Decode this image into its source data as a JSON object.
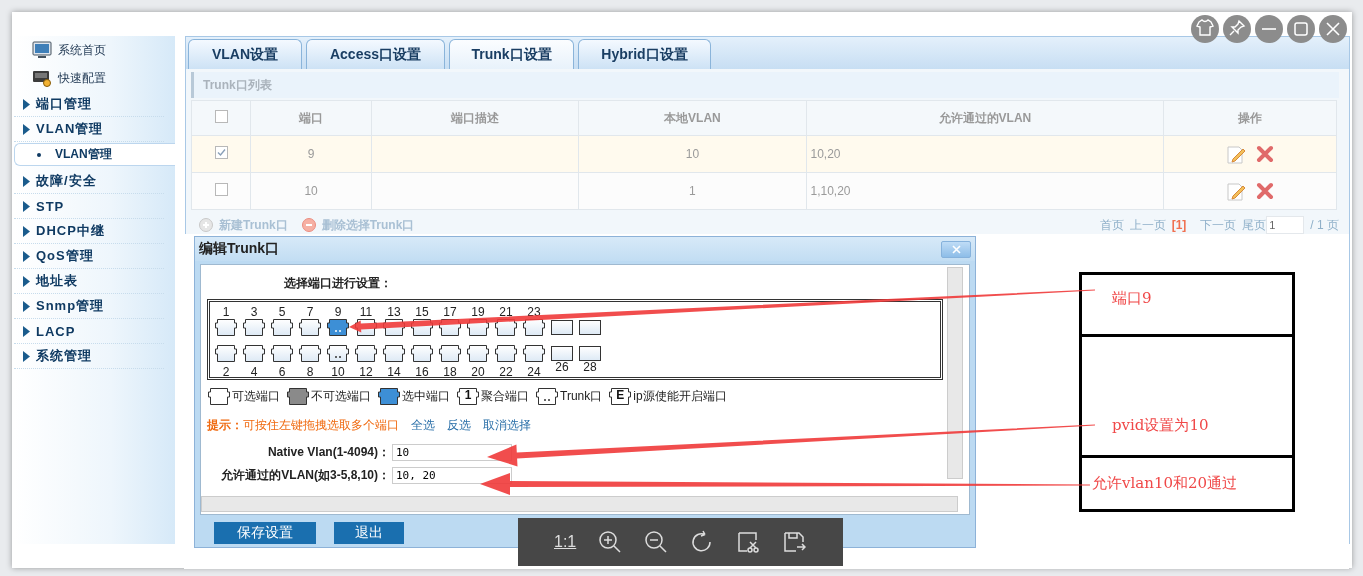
{
  "sidebar": {
    "items": [
      {
        "kind": "shortcut",
        "label": "系统首页"
      },
      {
        "kind": "shortcut",
        "label": "快速配置"
      },
      {
        "kind": "group",
        "label": "端口管理"
      },
      {
        "kind": "group",
        "label": "VLAN管理",
        "children": [
          {
            "label": "VLAN管理",
            "selected": true
          }
        ]
      },
      {
        "kind": "group",
        "label": "故障/安全"
      },
      {
        "kind": "group",
        "label": "STP"
      },
      {
        "kind": "group",
        "label": "DHCP中继"
      },
      {
        "kind": "group",
        "label": "QoS管理"
      },
      {
        "kind": "group",
        "label": "地址表"
      },
      {
        "kind": "group",
        "label": "Snmp管理"
      },
      {
        "kind": "group",
        "label": "LACP"
      },
      {
        "kind": "group",
        "label": "系统管理"
      }
    ]
  },
  "tabs": [
    {
      "label": "VLAN设置",
      "selected": false
    },
    {
      "label": "Access口设置",
      "selected": false
    },
    {
      "label": "Trunk口设置",
      "selected": true
    },
    {
      "label": "Hybrid口设置",
      "selected": false
    }
  ],
  "list": {
    "title": "Trunk口列表",
    "header_checked": false,
    "columns": [
      "端口",
      "端口描述",
      "本地VLAN",
      "允许通过的VLAN",
      "操作"
    ],
    "rows": [
      {
        "checked": true,
        "port": "9",
        "local_vlan": "10",
        "allowed_vlan": "10,20"
      },
      {
        "checked": false,
        "port": "10",
        "local_vlan": "1",
        "allowed_vlan": "1,10,20"
      }
    ],
    "actions": [
      {
        "kind": "add",
        "label": "新建Trunk口"
      },
      {
        "kind": "delete",
        "label": "删除选择Trunk口"
      }
    ],
    "pagination": {
      "first": "首页",
      "prev": "上一页",
      "current": "[1]",
      "next": "下一页",
      "last": "尾页",
      "page_input": "1",
      "total": "/ 1 页"
    }
  },
  "dialog": {
    "title": "编辑Trunk口",
    "prompt": "选择端口进行设置：",
    "top_ports": [
      {
        "label": "1",
        "kind": "rj45",
        "selected": false,
        "trunk": false
      },
      {
        "label": "3",
        "kind": "rj45",
        "selected": false,
        "trunk": false
      },
      {
        "label": "5",
        "kind": "rj45",
        "selected": false,
        "trunk": false
      },
      {
        "label": "7",
        "kind": "rj45",
        "selected": false,
        "trunk": false
      },
      {
        "label": "9",
        "kind": "rj45",
        "selected": true,
        "trunk": true
      },
      {
        "label": "11",
        "kind": "rj45",
        "selected": false,
        "trunk": false
      },
      {
        "label": "13",
        "kind": "rj45",
        "selected": false,
        "trunk": false
      },
      {
        "label": "15",
        "kind": "rj45",
        "selected": false,
        "trunk": false
      },
      {
        "label": "17",
        "kind": "rj45",
        "selected": false,
        "trunk": false
      },
      {
        "label": "19",
        "kind": "rj45",
        "selected": false,
        "trunk": false
      },
      {
        "label": "21",
        "kind": "rj45",
        "selected": false,
        "trunk": false
      },
      {
        "label": "23",
        "kind": "rj45",
        "selected": false,
        "trunk": false
      },
      {
        "kind": "sfp",
        "selected": false,
        "trunk": false
      },
      {
        "kind": "sfp",
        "selected": false,
        "trunk": false
      }
    ],
    "bottom_ports": [
      {
        "label": "2",
        "kind": "rj45",
        "selected": false,
        "trunk": false
      },
      {
        "label": "4",
        "kind": "rj45",
        "selected": false,
        "trunk": false
      },
      {
        "label": "6",
        "kind": "rj45",
        "selected": false,
        "trunk": false
      },
      {
        "label": "8",
        "kind": "rj45",
        "selected": false,
        "trunk": false
      },
      {
        "label": "10",
        "kind": "rj45",
        "selected": false,
        "trunk": true
      },
      {
        "label": "12",
        "kind": "rj45",
        "selected": false,
        "trunk": false
      },
      {
        "label": "14",
        "kind": "rj45",
        "selected": false,
        "trunk": false
      },
      {
        "label": "16",
        "kind": "rj45",
        "selected": false,
        "trunk": false
      },
      {
        "label": "18",
        "kind": "rj45",
        "selected": false,
        "trunk": false
      },
      {
        "label": "20",
        "kind": "rj45",
        "selected": false,
        "trunk": false
      },
      {
        "label": "22",
        "kind": "rj45",
        "selected": false,
        "trunk": false
      },
      {
        "label": "24",
        "kind": "rj45",
        "selected": false,
        "trunk": false
      },
      {
        "label": "26",
        "kind": "sfp",
        "selected": false,
        "trunk": false
      },
      {
        "label": "28",
        "kind": "sfp",
        "selected": false,
        "trunk": false
      }
    ],
    "legend": [
      {
        "kind": "available",
        "label": "可选端口"
      },
      {
        "kind": "unavailable",
        "label": "不可选端口"
      },
      {
        "kind": "selected",
        "label": "选中端口"
      },
      {
        "kind": "aggregate",
        "glyph": "1",
        "label": "聚合端口"
      },
      {
        "kind": "trunk",
        "label": "Trunk口"
      },
      {
        "kind": "ip_source",
        "glyph": "E",
        "label": "ip源使能开启端口"
      }
    ],
    "hint": "**提示：**可按住左键拖拽选取多个端口",
    "hint_links": [
      "全选",
      "反选",
      "取消选择"
    ],
    "fields": [
      {
        "label": "Native Vlan(1-4094)：",
        "value": "10"
      },
      {
        "label": "允许通过的VLAN(如3-5,8,10)：",
        "value": "10, 20"
      }
    ],
    "buttons": [
      "保存设置",
      "退出"
    ]
  },
  "annotations": [
    "端口9",
    "pvid设置为10",
    "允许vlan10和20通过"
  ],
  "viewer_toolbar": {
    "actual_size": "1:1"
  }
}
